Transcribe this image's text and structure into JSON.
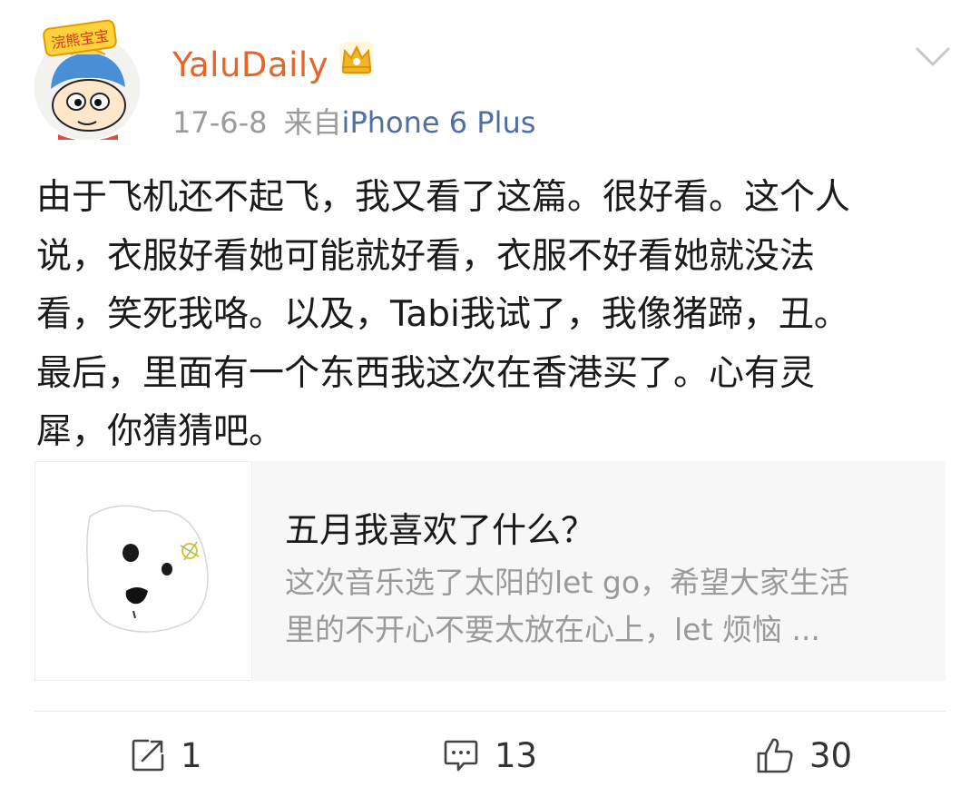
{
  "post": {
    "username": "YaluDaily",
    "date": "17-6-8",
    "source_prefix": "来自",
    "source_device": "iPhone 6 Plus",
    "avatar_badge_text": "浣熊宝宝",
    "text_lines": [
      "由于飞机还不起飞，我又看了这篇。很好看。这个人",
      "说，衣服好看她可能就好看，衣服不好看她就没法",
      "看，笑死我咯。以及，Tabi我试了，我像猪蹄，丑。",
      "最后，里面有一个东西我这次在香港买了。心有灵",
      "犀，你猜猜吧。"
    ]
  },
  "card": {
    "title": "五月我喜欢了什么？",
    "desc_lines": [
      "这次音乐选了太阳的let go，希望大家生活",
      "里的不开心不要太放在心上，let 烦恼 ..."
    ]
  },
  "actions": {
    "repost_count": "1",
    "comment_count": "13",
    "like_count": "30"
  },
  "icons": {
    "crown": "crown-icon",
    "chevron": "chevron-down-icon",
    "repost": "repost-icon",
    "comment": "comment-icon",
    "like": "thumbs-up-icon"
  },
  "colors": {
    "username": "#e8652a",
    "source": "#4f6fa0",
    "meta": "#9b9b9b",
    "card_bg": "#f7f7f7"
  }
}
